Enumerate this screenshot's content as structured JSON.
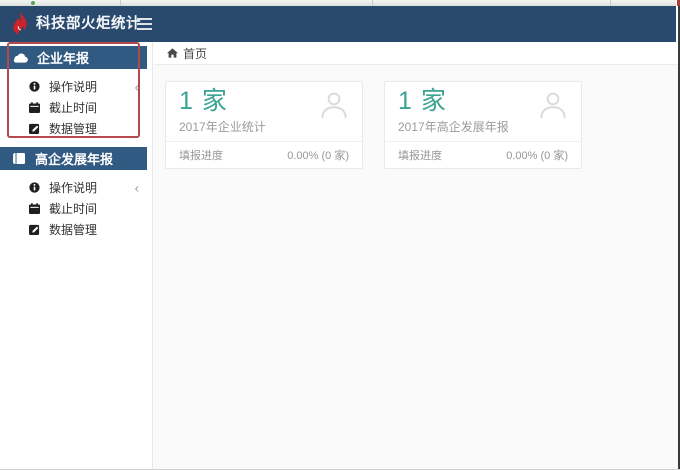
{
  "navbar": {
    "title": "科技部火炬统计",
    "logo_icon": "torch-flame-icon",
    "menu_toggle_icon": "hamburger-icon"
  },
  "sidebar": {
    "sections": [
      {
        "label": "企业年报",
        "icon": "cloud-icon",
        "items": [
          {
            "label": "操作说明",
            "icon": "info-circle-icon",
            "chevron": "‹"
          },
          {
            "label": "截止时间",
            "icon": "calendar-icon"
          },
          {
            "label": "数据管理",
            "icon": "edit-icon"
          }
        ]
      },
      {
        "label": "高企发展年报",
        "icon": "book-icon",
        "items": [
          {
            "label": "操作说明",
            "icon": "info-circle-icon",
            "chevron": "‹"
          },
          {
            "label": "截止时间",
            "icon": "calendar-icon"
          },
          {
            "label": "数据管理",
            "icon": "edit-icon"
          }
        ]
      }
    ]
  },
  "breadcrumb": {
    "home_label": "首页",
    "home_icon": "home-icon"
  },
  "cards": [
    {
      "count": "1 家",
      "subtitle": "2017年企业统计",
      "footer_label": "填报进度",
      "footer_value": "0.00% (0 家)",
      "icon": "person-icon"
    },
    {
      "count": "1 家",
      "subtitle": "2017年高企发展年报",
      "footer_label": "填报进度",
      "footer_value": "0.00% (0 家)",
      "icon": "person-icon"
    }
  ],
  "colors": {
    "navbar_bg": "#294a6d",
    "section_header_bg": "#305a82",
    "accent_teal": "#3aa392",
    "annotation_red": "#b5494d",
    "logo_red": "#cc2229"
  }
}
